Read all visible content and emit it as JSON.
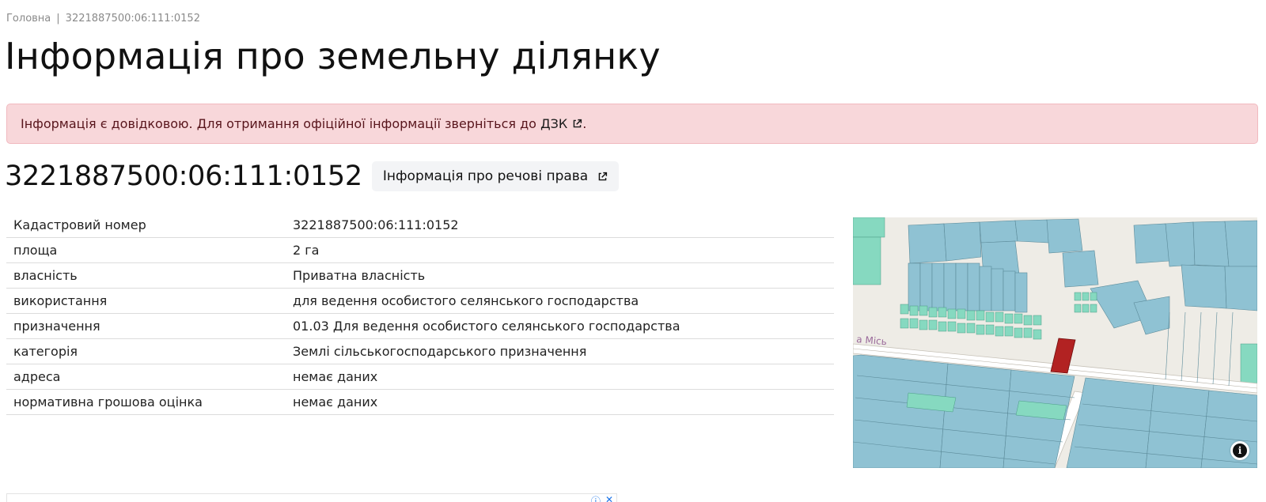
{
  "breadcrumb": {
    "home": "Головна",
    "separator": "|",
    "current": "3221887500:06:111:0152"
  },
  "page_title": "Інформація про земельну ділянку",
  "alert": {
    "text_before": "Інформація є довідковою. Для отримання офіційної інформації зверніться до ",
    "link": "ДЗК",
    "text_after": "."
  },
  "cadastral_number": "3221887500:06:111:0152",
  "rights_button": "Інформація про речові права",
  "info_table": [
    {
      "key": "Кадастровий номер",
      "value": "3221887500:06:111:0152"
    },
    {
      "key": "площа",
      "value": "2 га"
    },
    {
      "key": "власність",
      "value": "Приватна власність"
    },
    {
      "key": "використання",
      "value": "для ведення особистого селянського господарства"
    },
    {
      "key": "призначення",
      "value": "01.03 Для ведення особистого селянського господарства"
    },
    {
      "key": "категорія",
      "value": "Землі сільськогосподарського призначення"
    },
    {
      "key": "адреса",
      "value": "немає даних"
    },
    {
      "key": "нормативна грошова оцінка",
      "value": "немає даних"
    }
  ],
  "map": {
    "road_label": "а Місь",
    "info_icon": "info-icon",
    "colors": {
      "parcel": "#8fc2d3",
      "parcel_green": "#86d9c0",
      "highlight": "#b22222",
      "background": "#eeece6"
    }
  },
  "ad": {
    "icons": [
      "ad-info-icon",
      "ad-close-icon"
    ]
  }
}
